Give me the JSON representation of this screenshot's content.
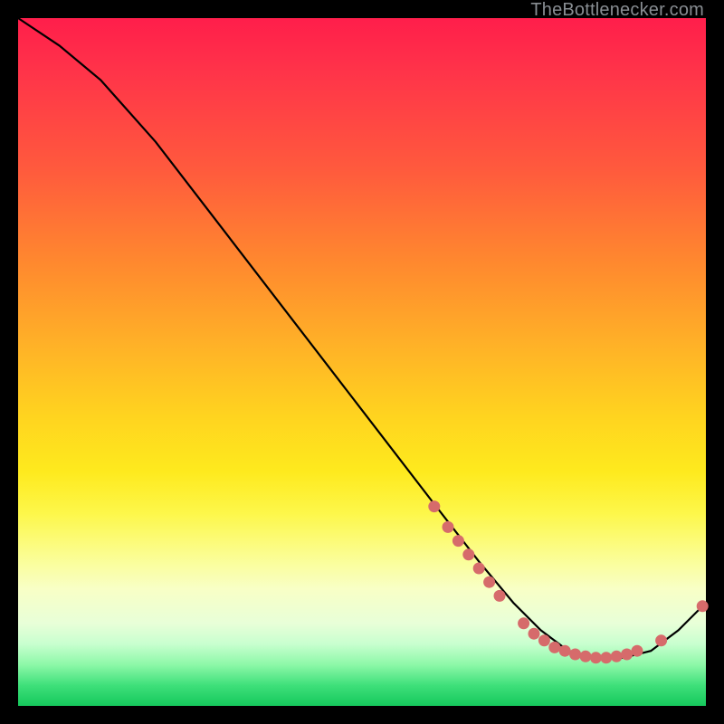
{
  "watermark": "TheBottlenecker.com",
  "chart_data": {
    "type": "line",
    "title": "",
    "xlabel": "",
    "ylabel": "",
    "xlim": [
      0,
      100
    ],
    "ylim": [
      0,
      100
    ],
    "series": [
      {
        "name": "curve",
        "x": [
          0,
          6,
          12,
          20,
          30,
          40,
          50,
          60,
          67,
          72,
          76,
          80,
          84,
          88,
          92,
          96,
          100
        ],
        "y": [
          100,
          96,
          91,
          82,
          69,
          56,
          43,
          30,
          21,
          15,
          11,
          8,
          7,
          7,
          8,
          11,
          15
        ]
      }
    ],
    "markers": [
      {
        "x": 60.5,
        "y": 29
      },
      {
        "x": 62.5,
        "y": 26
      },
      {
        "x": 64.0,
        "y": 24
      },
      {
        "x": 65.5,
        "y": 22
      },
      {
        "x": 67.0,
        "y": 20
      },
      {
        "x": 68.5,
        "y": 18
      },
      {
        "x": 70.0,
        "y": 16
      },
      {
        "x": 73.5,
        "y": 12
      },
      {
        "x": 75.0,
        "y": 10.5
      },
      {
        "x": 76.5,
        "y": 9.5
      },
      {
        "x": 78.0,
        "y": 8.5
      },
      {
        "x": 79.5,
        "y": 8
      },
      {
        "x": 81.0,
        "y": 7.5
      },
      {
        "x": 82.5,
        "y": 7.2
      },
      {
        "x": 84.0,
        "y": 7.0
      },
      {
        "x": 85.5,
        "y": 7.0
      },
      {
        "x": 87.0,
        "y": 7.2
      },
      {
        "x": 88.5,
        "y": 7.5
      },
      {
        "x": 90.0,
        "y": 8.0
      },
      {
        "x": 93.5,
        "y": 9.5
      },
      {
        "x": 99.5,
        "y": 14.5
      }
    ],
    "colors": {
      "curve": "#000000",
      "marker_fill": "#d66b6b",
      "marker_stroke": "#c45a5a"
    }
  }
}
